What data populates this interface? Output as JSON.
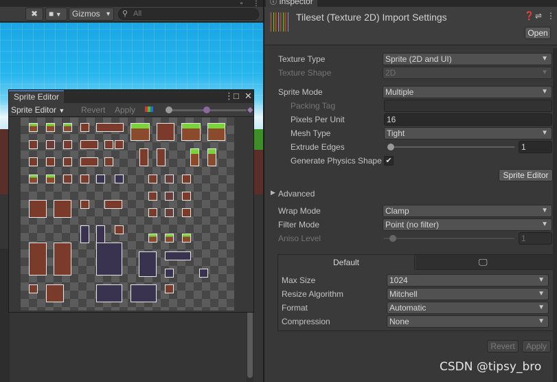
{
  "scene": {
    "gizmos_label": "Gizmos",
    "search_placeholder": "All"
  },
  "sprite_editor": {
    "tab_title": "Sprite Editor",
    "mode_label": "Sprite Editor",
    "revert_label": "Revert",
    "apply_label": "Apply"
  },
  "inspector": {
    "tab_title": "Inspector",
    "asset_title": "Tileset (Texture 2D) Import Settings",
    "open_label": "Open",
    "fields": {
      "texture_type": {
        "label": "Texture Type",
        "value": "Sprite (2D and UI)"
      },
      "texture_shape": {
        "label": "Texture Shape",
        "value": "2D"
      },
      "sprite_mode": {
        "label": "Sprite Mode",
        "value": "Multiple"
      },
      "packing_tag": {
        "label": "Packing Tag",
        "value": ""
      },
      "pixels_per_unit": {
        "label": "Pixels Per Unit",
        "value": "16"
      },
      "mesh_type": {
        "label": "Mesh Type",
        "value": "Tight"
      },
      "extrude_edges": {
        "label": "Extrude Edges",
        "value": "1"
      },
      "generate_physics_shape": {
        "label": "Generate Physics Shape",
        "checked": true
      }
    },
    "sprite_editor_button": "Sprite Editor",
    "advanced_label": "Advanced",
    "wrap_mode": {
      "label": "Wrap Mode",
      "value": "Clamp"
    },
    "filter_mode": {
      "label": "Filter Mode",
      "value": "Point (no filter)"
    },
    "aniso_level": {
      "label": "Aniso Level",
      "value": "1"
    },
    "platform_tabs": {
      "default_label": "Default",
      "standalone_icon": "monitor-icon"
    },
    "platform": {
      "max_size": {
        "label": "Max Size",
        "value": "1024"
      },
      "resize_algorithm": {
        "label": "Resize Algorithm",
        "value": "Mitchell"
      },
      "format": {
        "label": "Format",
        "value": "Automatic"
      },
      "compression": {
        "label": "Compression",
        "value": "None"
      }
    },
    "revert_label": "Revert",
    "apply_label": "Apply"
  },
  "watermark": "CSDN @tipsy_bro"
}
